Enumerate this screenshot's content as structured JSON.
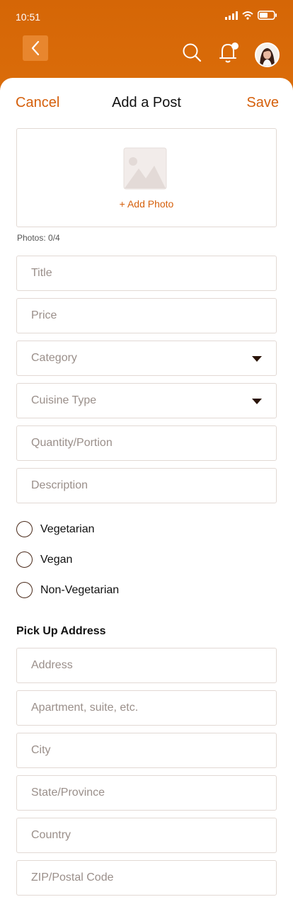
{
  "status": {
    "time": "10:51"
  },
  "header": {
    "back_icon": "chevron-left-icon",
    "search_icon": "search-icon",
    "bell_icon": "bell-icon",
    "avatar_alt": "user avatar"
  },
  "nav": {
    "cancel": "Cancel",
    "title": "Add a Post",
    "save": "Save"
  },
  "photo": {
    "add_label": "+ Add Photo",
    "count": "Photos: 0/4"
  },
  "fields": {
    "title": "Title",
    "price": "Price",
    "category": "Category",
    "cuisine": "Cuisine Type",
    "quantity": "Quantity/Portion",
    "description": "Description"
  },
  "diet": [
    "Vegetarian",
    "Vegan",
    "Non-Vegetarian"
  ],
  "pickup": {
    "title": "Pick Up Address",
    "address": "Address",
    "apartment": "Apartment, suite, etc.",
    "city": "City",
    "state": "State/Province",
    "country": "Country",
    "zip": "ZIP/Postal Code"
  },
  "colors": {
    "accent": "#d5600c",
    "header": "#d86a08"
  }
}
